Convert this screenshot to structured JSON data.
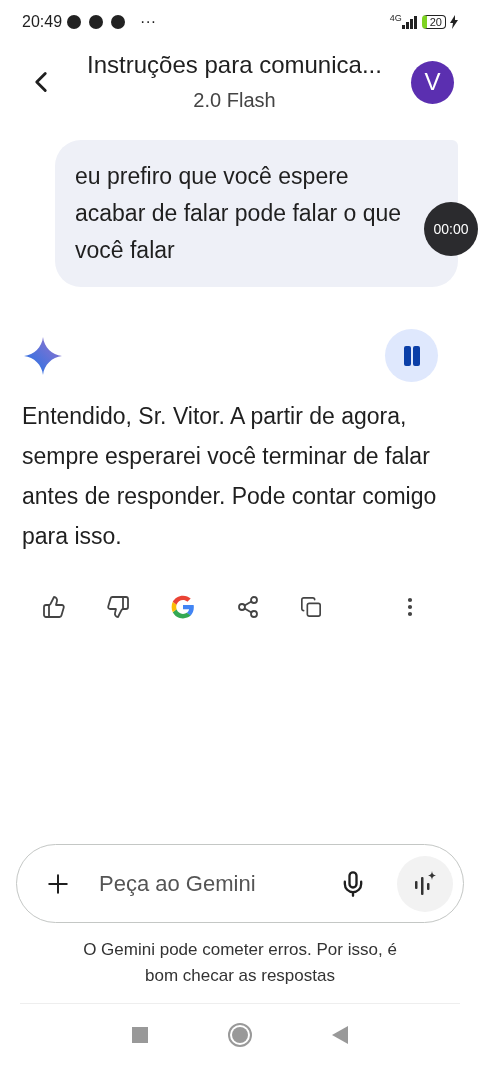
{
  "status_bar": {
    "time": "20:49",
    "more": "···",
    "network": "4G",
    "battery": "20"
  },
  "header": {
    "title": "Instruções para comunica...",
    "subtitle": "2.0 Flash",
    "avatar": "V"
  },
  "user_message": {
    "text": "eu prefiro que você espere acabar de falar pode falar o que você falar"
  },
  "timer_overlay": "00:00",
  "response": {
    "playing": true,
    "text": "Entendido, Sr. Vitor. A partir de agora, sempre esperarei você terminar de falar antes de responder. Pode contar comigo para isso."
  },
  "actions": [
    {
      "kind": "like"
    },
    {
      "kind": "dislike"
    },
    {
      "kind": "google"
    },
    {
      "kind": "share"
    },
    {
      "kind": "copy"
    },
    {
      "kind": "more"
    }
  ],
  "composer": {
    "placeholder": "Peça ao Gemini"
  },
  "disclaimer": "O Gemini pode cometer erros. Por isso, é bom checar as respostas"
}
